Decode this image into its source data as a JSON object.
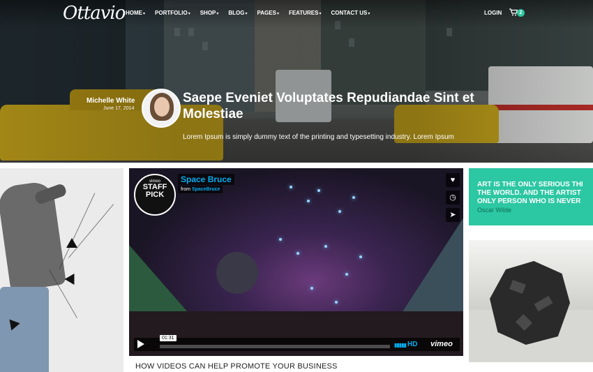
{
  "header": {
    "logo_text": "Ottavio",
    "nav": [
      {
        "label": "HOME"
      },
      {
        "label": "PORTFOLIO"
      },
      {
        "label": "SHOP"
      },
      {
        "label": "BLOG"
      },
      {
        "label": "PAGES"
      },
      {
        "label": "FEATURES"
      },
      {
        "label": "CONTACT US"
      }
    ],
    "login_label": "LOGIN",
    "cart_icon": "cart-icon",
    "cart_count": "2"
  },
  "hero": {
    "author_name": "Michelle White",
    "date": "June 17, 2014",
    "title": "Saepe Eveniet Voluptates Repudiandae Sint et Molestiae",
    "subtitle": "Lorem Ipsum is simply dummy text of the printing and typesetting industry. Lorem Ipsum"
  },
  "video": {
    "badge_top": "vimeo",
    "badge_main": "STAFF PICK",
    "title": "Space Bruce",
    "from_label": "from",
    "channel": "SpaceBruce",
    "side_icons": [
      "heart-icon",
      "clock-icon",
      "send-icon"
    ],
    "time": "01:31",
    "hd_label": "HD",
    "brand": "vimeo",
    "caption": "HOW VIDEOS CAN HELP PROMOTE YOUR BUSINESS"
  },
  "quote": {
    "text": "ART IS THE ONLY SERIOUS THI\nTHE WORLD. AND THE ARTIST\nONLY PERSON WHO IS NEVER",
    "author": "Oscar Wilde"
  },
  "colors": {
    "accent": "#2cc7a3",
    "vimeo_blue": "#00adef"
  }
}
